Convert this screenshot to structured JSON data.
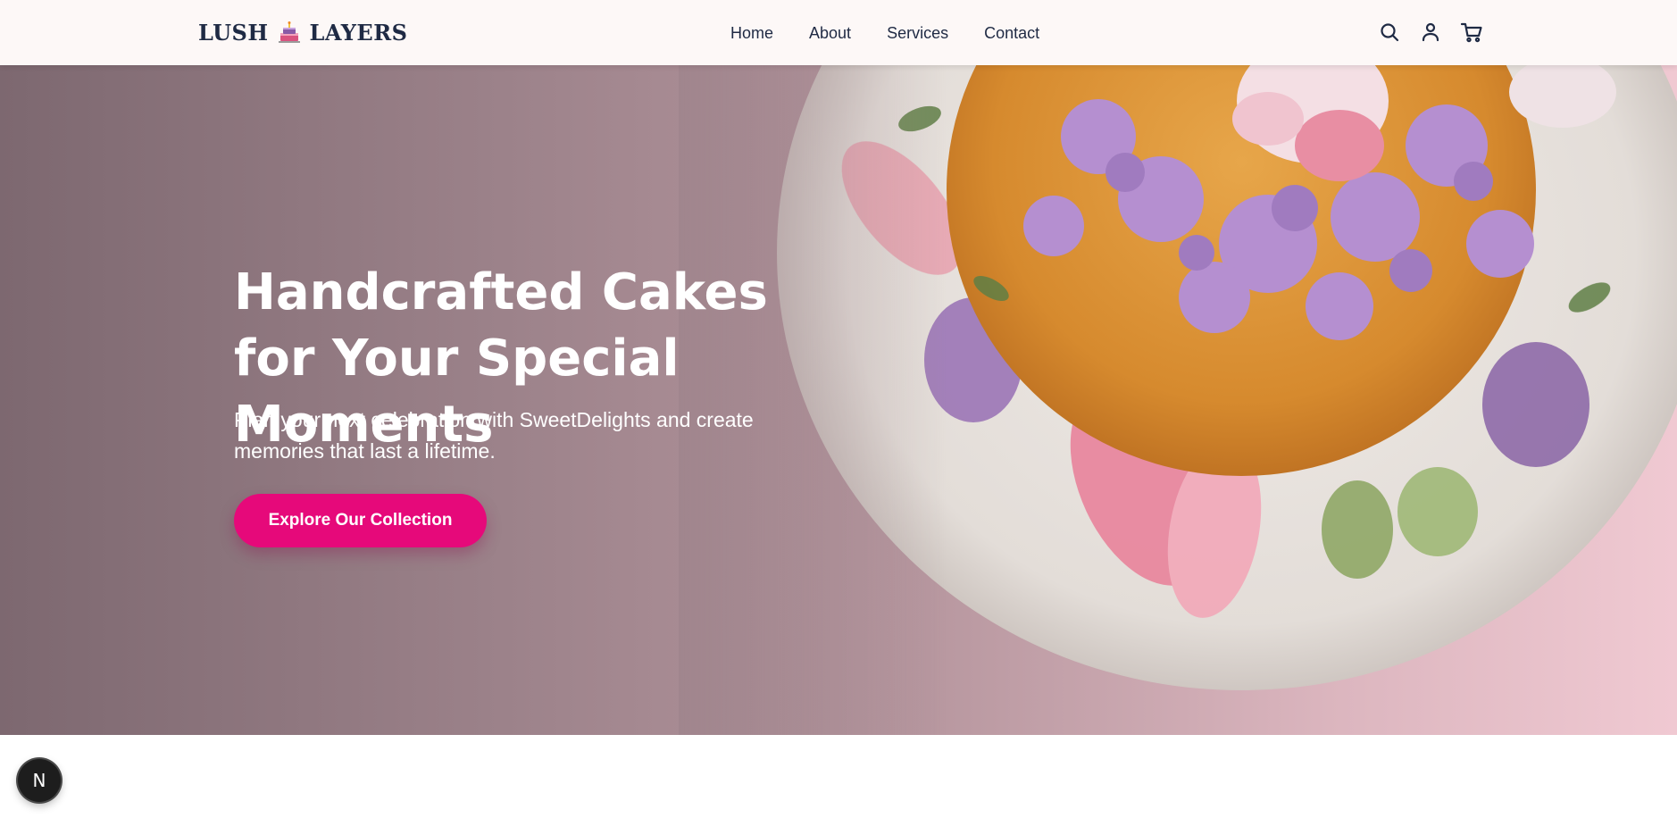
{
  "header": {
    "logo_left": "LUSH",
    "logo_right": "LAYERS",
    "logo_icon": "cake-icon",
    "nav": [
      {
        "label": "Home"
      },
      {
        "label": "About"
      },
      {
        "label": "Services"
      },
      {
        "label": "Contact"
      }
    ],
    "icons": [
      "search-icon",
      "user-icon",
      "cart-icon"
    ]
  },
  "hero": {
    "title": "Handcrafted Cakes for Your Special Moments",
    "subtitle": "Plan your next celebration with SweetDelights and create memories that last a lifetime.",
    "cta_label": "Explore Our Collection"
  },
  "badge": {
    "letter": "N",
    "icon": "nextjs-icon"
  },
  "colors": {
    "accent": "#e6097a",
    "text_dark": "#1f2a44",
    "header_bg": "#fdf8f7"
  }
}
